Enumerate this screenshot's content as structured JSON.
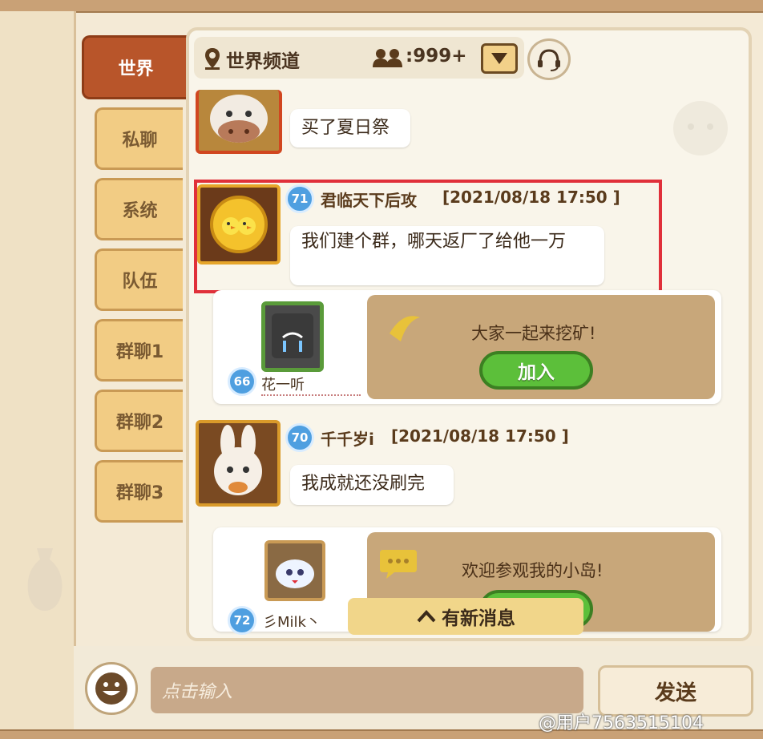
{
  "tabs": [
    {
      "label": "世界"
    },
    {
      "label": "私聊"
    },
    {
      "label": "系统"
    },
    {
      "label": "队伍"
    },
    {
      "label": "群聊1"
    },
    {
      "label": "群聊2"
    },
    {
      "label": "群聊3"
    }
  ],
  "header": {
    "channel_title": "世界频道",
    "online_count": ":999+",
    "icons": [
      "pin-icon",
      "people-icon",
      "dropdown-triangle-icon",
      "headset-icon"
    ]
  },
  "messages": [
    {
      "avatar": "cow-avatar",
      "text": "买了夏日祭"
    },
    {
      "avatar": "chick-medal-avatar",
      "level": "71",
      "sender": "君临天下后攻",
      "time": "[2021/08/18 17:50 ]",
      "text": "我们建个群，哪天返厂了给他一万"
    },
    {
      "avatar": "rabbit-avatar",
      "level": "70",
      "sender": "千千岁i",
      "time": "[2021/08/18 17:50 ]",
      "text": "我成就还没刷完"
    }
  ],
  "cards": [
    {
      "level": "66",
      "name": "花一听",
      "text": "大家一起来挖矿!",
      "button": "加入",
      "icon": "banana-icon"
    },
    {
      "level": "72",
      "name": "彡Milk丶",
      "text": "欢迎参观我的小岛!",
      "button": "加入",
      "icon": "speech-bubble-icon"
    }
  ],
  "new_message_notice": "有新消息",
  "input": {
    "placeholder": "点击输入"
  },
  "send_label": "发送",
  "watermark": "@用户7563515104",
  "colors": {
    "active_tab": "#b8552a",
    "tab": "#f2cc84",
    "highlight": "#e0303a",
    "join_button": "#5cbf3a",
    "level_badge": "#4f9fe0"
  }
}
